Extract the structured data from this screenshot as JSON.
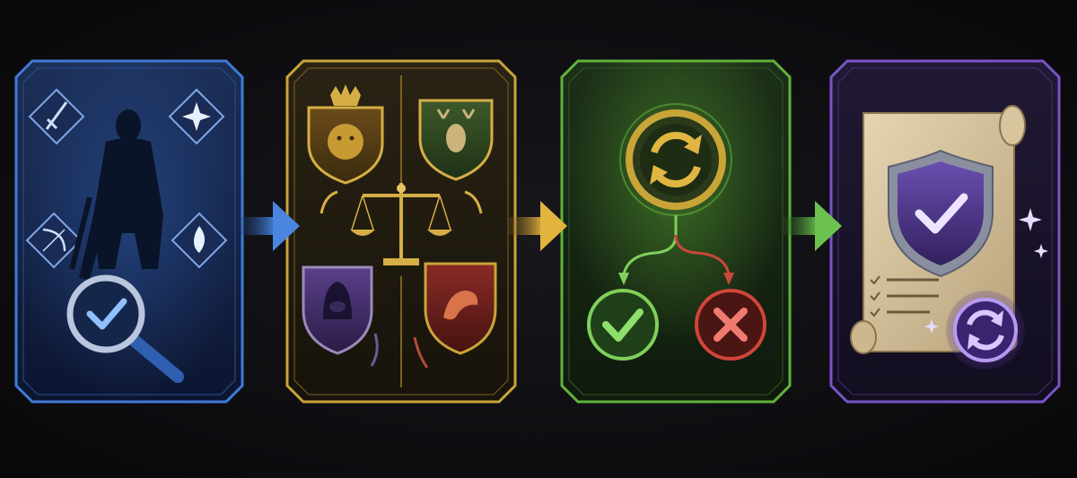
{
  "panels": [
    {
      "id": "character-inspection",
      "accent": "#3f7ad6",
      "icons": [
        "sword-icon",
        "starburst-icon",
        "bow-icon",
        "flame-icon",
        "hero-silhouette-icon",
        "magnifier-check-icon"
      ]
    },
    {
      "id": "faction-balance",
      "accent": "#c9a437",
      "icons": [
        "lion-crest-icon",
        "stag-crest-icon",
        "scales-icon",
        "hooded-crest-icon",
        "dragon-crest-icon"
      ]
    },
    {
      "id": "validation-cycle",
      "accent": "#5fb23a",
      "icons": [
        "refresh-emblem-icon",
        "approve-check-icon",
        "reject-cross-icon"
      ]
    },
    {
      "id": "approved-record",
      "accent": "#7b54c7",
      "icons": [
        "scroll-icon",
        "shield-check-icon",
        "checklist-icon",
        "sync-orb-icon",
        "sparkle-icon"
      ]
    }
  ],
  "connectors": [
    {
      "from": "character-inspection",
      "to": "faction-balance",
      "color": "#3f7ad6"
    },
    {
      "from": "faction-balance",
      "to": "validation-cycle",
      "color": "#d0a53a"
    },
    {
      "from": "validation-cycle",
      "to": "approved-record",
      "color": "#5fa84a"
    }
  ],
  "colors": {
    "background": "#0f0f12",
    "blue": "#3f7ad6",
    "gold": "#c9a437",
    "green": "#5fb23a",
    "purple": "#7b54c7",
    "approve": "#6fd25a",
    "reject": "#d0453a"
  }
}
